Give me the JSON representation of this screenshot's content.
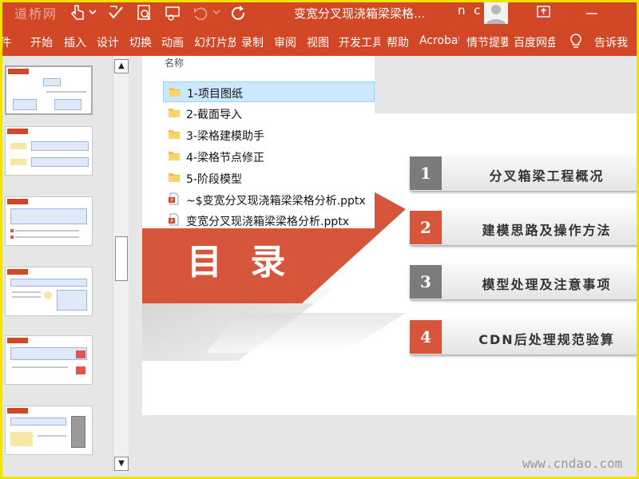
{
  "titlebar": {
    "watermark": "道桥网",
    "title": "变宽分叉现浇箱梁梁格...",
    "user": "n c"
  },
  "ribbon": {
    "tabs": [
      "件",
      "开始",
      "插入",
      "设计",
      "切换",
      "动画",
      "幻灯片放映",
      "录制",
      "审阅",
      "视图",
      "开发工具",
      "帮助",
      "Acrobat",
      "情节提要",
      "百度网盘",
      "告诉我"
    ]
  },
  "file_panel": {
    "label": "名称",
    "items": [
      {
        "name": "1-项目图纸",
        "type": "folder"
      },
      {
        "name": "2-截面导入",
        "type": "folder"
      },
      {
        "name": "3-梁格建模助手",
        "type": "folder"
      },
      {
        "name": "4-梁格节点修正",
        "type": "folder"
      },
      {
        "name": "5-阶段模型",
        "type": "folder"
      },
      {
        "name": "~$变宽分叉现浇箱梁梁格分析.pptx",
        "type": "pptx"
      },
      {
        "name": "变宽分叉现浇箱梁梁格分析.pptx",
        "type": "pptx"
      }
    ]
  },
  "slide": {
    "heading": "目 录",
    "toc": [
      {
        "num": "1",
        "text": "分叉箱梁工程概况"
      },
      {
        "num": "2",
        "text": "建模思路及操作方法"
      },
      {
        "num": "3",
        "text": "模型处理及注意事项"
      },
      {
        "num": "4",
        "text": "CDN后处理规范验算"
      }
    ]
  },
  "watermark_bottom": "www.cndao.com",
  "colors": {
    "accent": "#d24726",
    "toc_red": "#d6563c",
    "toc_gray": "#7b7b7b",
    "selection": "#cce8ff",
    "folder": "#f0c24a"
  }
}
